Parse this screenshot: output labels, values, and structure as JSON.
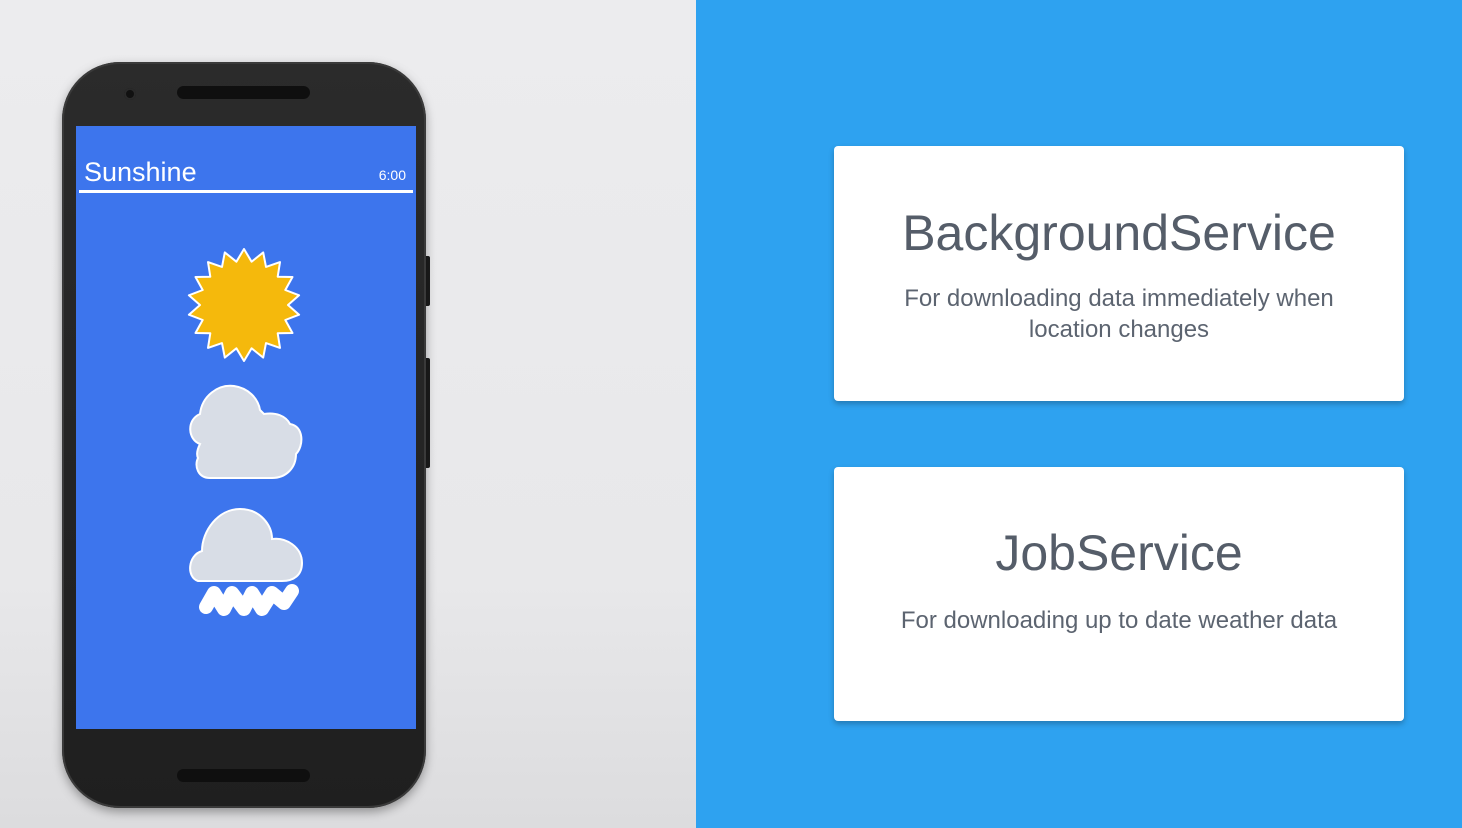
{
  "app": {
    "title": "Sunshine",
    "time": "6:00",
    "forecast_icons": [
      "sun-icon",
      "cloud-icon",
      "rain-icon"
    ]
  },
  "cards": [
    {
      "title": "BackgroundService",
      "description": "For downloading data immediately when location changes"
    },
    {
      "title": "JobService",
      "description": "For downloading up to date weather data"
    }
  ],
  "colors": {
    "right_background": "#2ea2f0",
    "screen_background": "#3d75ed",
    "sun": "#f5b90c",
    "cloud": "#d8dde6"
  }
}
